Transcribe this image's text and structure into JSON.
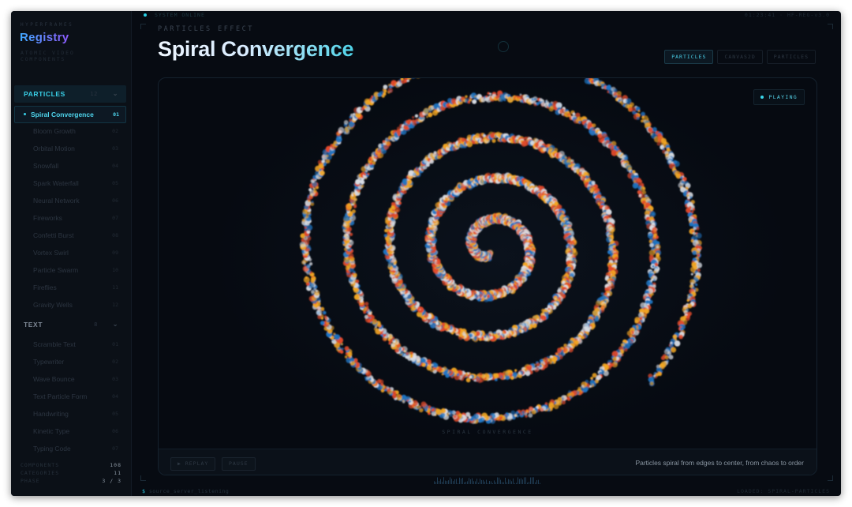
{
  "brand": {
    "small": "HYPERFRAMES",
    "name": "Registry",
    "subtitle": "ATOMIC VIDEO COMPONENTS"
  },
  "sidebar": {
    "categories": [
      {
        "label": "PARTICLES",
        "count": "12",
        "items": [
          {
            "label": "Spiral Convergence",
            "no": "01",
            "active": true
          },
          {
            "label": "Bloom Growth",
            "no": "02"
          },
          {
            "label": "Orbital Motion",
            "no": "03"
          },
          {
            "label": "Snowfall",
            "no": "04"
          },
          {
            "label": "Spark Waterfall",
            "no": "05"
          },
          {
            "label": "Neural Network",
            "no": "06"
          },
          {
            "label": "Fireworks",
            "no": "07"
          },
          {
            "label": "Confetti Burst",
            "no": "08"
          },
          {
            "label": "Vortex Swirl",
            "no": "09"
          },
          {
            "label": "Particle Swarm",
            "no": "10"
          },
          {
            "label": "Fireflies",
            "no": "11"
          },
          {
            "label": "Gravity Wells",
            "no": "12"
          }
        ]
      },
      {
        "label": "TEXT",
        "count": "8",
        "items": [
          {
            "label": "Scramble Text",
            "no": "01"
          },
          {
            "label": "Typewriter",
            "no": "02"
          },
          {
            "label": "Wave Bounce",
            "no": "03"
          },
          {
            "label": "Text Particle Form",
            "no": "04"
          },
          {
            "label": "Handwriting",
            "no": "05"
          },
          {
            "label": "Kinetic Type",
            "no": "06"
          },
          {
            "label": "Typing Code",
            "no": "07"
          }
        ]
      }
    ],
    "stats": [
      {
        "label": "COMPONENTS",
        "value": "108"
      },
      {
        "label": "CATEGORIES",
        "value": "11"
      },
      {
        "label": "PHASE",
        "value": "3 / 3"
      }
    ]
  },
  "header": {
    "status": "SYSTEM ONLINE",
    "clock": "01:23:41 · HF-REG-v3.0",
    "eyebrow": "PARTICLES EFFECT",
    "title": "Spiral Convergence",
    "tags": [
      "PARTICLES",
      "CANVAS2D",
      "PARTICLES"
    ]
  },
  "stage": {
    "playing": "PLAYING",
    "caption": "SPIRAL CONVERGENCE",
    "replay": "▶ REPLAY",
    "pause": "PAUSE",
    "description": "Particles spiral from edges to center, from chaos to order"
  },
  "footer": {
    "prompt_symbol": "$",
    "prompt": "source_server_listening",
    "loaded": "LOADED: SPIRAL-PARTICLES"
  },
  "colors": {
    "accent": "#39d0e8",
    "particles": [
      "#e24a2a",
      "#f2a622",
      "#1f76c4",
      "#d9dde4"
    ]
  }
}
